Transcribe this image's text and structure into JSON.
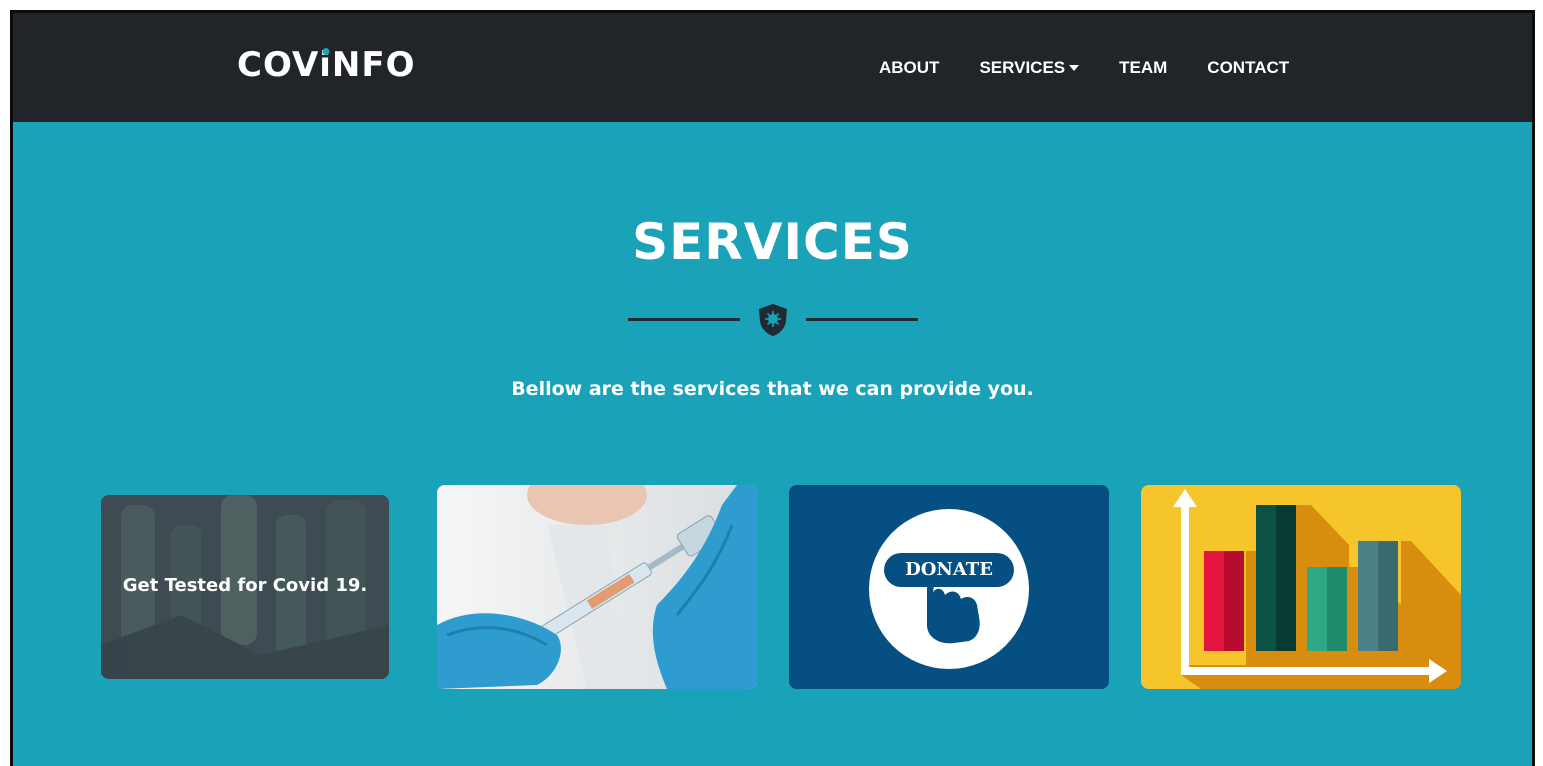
{
  "brand": {
    "prefix": "COV",
    "i": "i",
    "suffix": "NFO"
  },
  "nav": {
    "about": "ABOUT",
    "services": "SERVICES",
    "team": "TEAM",
    "contact": "CONTACT"
  },
  "section": {
    "title": "SERVICES",
    "subtitle": "Bellow are the services that we can provide you."
  },
  "cards": [
    {
      "caption": "Get Tested for Covid 19."
    },
    {
      "image": "vaccine-syringe"
    },
    {
      "label": "DONATE"
    },
    {
      "image": "bar-chart-statistics"
    }
  ],
  "colors": {
    "navbar": "#212429",
    "accent": "#19a2b8",
    "donate_bg": "#054f82",
    "stats_bg": "#f6c52b"
  }
}
